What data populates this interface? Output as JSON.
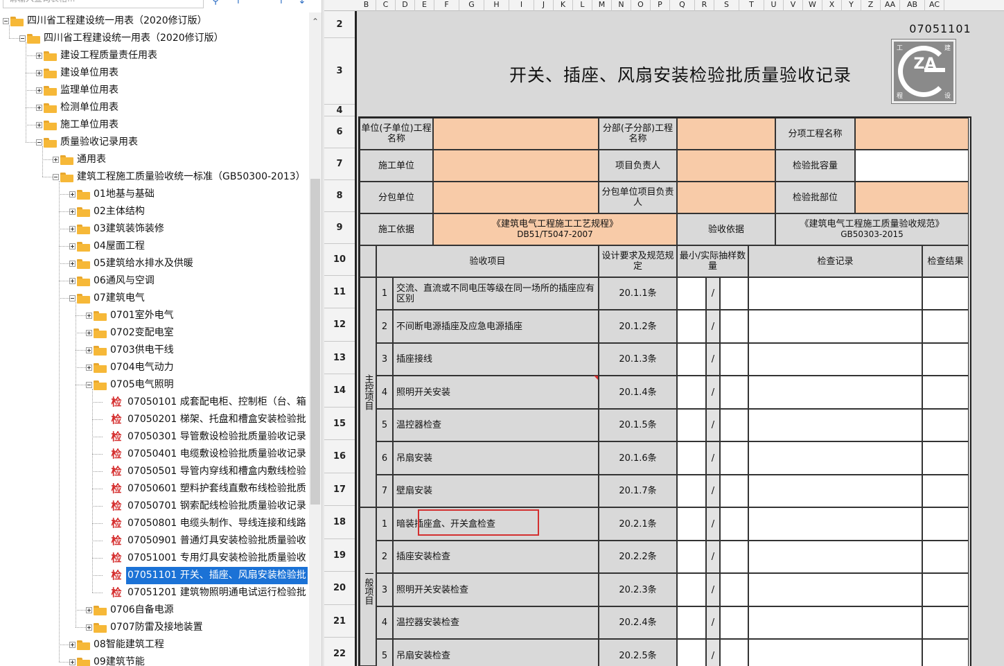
{
  "tree": {
    "search_placeholder": "请输入查询表格...",
    "nodes": [
      {
        "label": "四川省工程建设统一用表（2020修订版）",
        "indent": 0,
        "type": "folder",
        "expanded": true
      },
      {
        "label": "四川省工程建设统一用表（2020修订版）",
        "indent": 1,
        "type": "folder",
        "expanded": true
      },
      {
        "label": "建设工程质量责任用表",
        "indent": 2,
        "type": "folder",
        "expanded": false
      },
      {
        "label": "建设单位用表",
        "indent": 2,
        "type": "folder",
        "expanded": false
      },
      {
        "label": "监理单位用表",
        "indent": 2,
        "type": "folder",
        "expanded": false
      },
      {
        "label": "检测单位用表",
        "indent": 2,
        "type": "folder",
        "expanded": false
      },
      {
        "label": "施工单位用表",
        "indent": 2,
        "type": "folder",
        "expanded": false
      },
      {
        "label": "质量验收记录用表",
        "indent": 2,
        "type": "folder",
        "expanded": true
      },
      {
        "label": "通用表",
        "indent": 3,
        "type": "folder",
        "expanded": false
      },
      {
        "label": "建筑工程施工质量验收统一标准（GB50300-2013）",
        "indent": 3,
        "type": "folder",
        "expanded": true
      },
      {
        "label": "01地基与基础",
        "indent": 4,
        "type": "folder",
        "expanded": false
      },
      {
        "label": "02主体结构",
        "indent": 4,
        "type": "folder",
        "expanded": false
      },
      {
        "label": "03建筑装饰装修",
        "indent": 4,
        "type": "folder",
        "expanded": false
      },
      {
        "label": "04屋面工程",
        "indent": 4,
        "type": "folder",
        "expanded": false
      },
      {
        "label": "05建筑给水排水及供暖",
        "indent": 4,
        "type": "folder",
        "expanded": false
      },
      {
        "label": "06通风与空调",
        "indent": 4,
        "type": "folder",
        "expanded": false
      },
      {
        "label": "07建筑电气",
        "indent": 4,
        "type": "folder",
        "expanded": true
      },
      {
        "label": "0701室外电气",
        "indent": 5,
        "type": "folder",
        "expanded": false
      },
      {
        "label": "0702变配电室",
        "indent": 5,
        "type": "folder",
        "expanded": false
      },
      {
        "label": "0703供电干线",
        "indent": 5,
        "type": "folder",
        "expanded": false
      },
      {
        "label": "0704电气动力",
        "indent": 5,
        "type": "folder",
        "expanded": false
      },
      {
        "label": "0705电气照明",
        "indent": 5,
        "type": "folder",
        "expanded": true
      },
      {
        "label": "07050101 成套配电柜、控制柜（台、箱",
        "indent": 6,
        "type": "doc"
      },
      {
        "label": "07050201 梯架、托盘和槽盒安装检验批",
        "indent": 6,
        "type": "doc"
      },
      {
        "label": "07050301 导管敷设检验批质量验收记录",
        "indent": 6,
        "type": "doc"
      },
      {
        "label": "07050401 电缆敷设检验批质量验收记录",
        "indent": 6,
        "type": "doc"
      },
      {
        "label": "07050501 导管内穿线和槽盒内敷线检验",
        "indent": 6,
        "type": "doc"
      },
      {
        "label": "07050601 塑料护套线直敷布线检验批质",
        "indent": 6,
        "type": "doc"
      },
      {
        "label": "07050701 钢索配线检验批质量验收记录",
        "indent": 6,
        "type": "doc"
      },
      {
        "label": "07050801 电缆头制作、导线连接和线路",
        "indent": 6,
        "type": "doc"
      },
      {
        "label": "07050901 普通灯具安装检验批质量验收",
        "indent": 6,
        "type": "doc"
      },
      {
        "label": "07051001 专用灯具安装检验批质量验收",
        "indent": 6,
        "type": "doc"
      },
      {
        "label": "07051101 开关、插座、风扇安装检验批",
        "indent": 6,
        "type": "doc",
        "selected": true
      },
      {
        "label": "07051201 建筑物照明通电试运行检验批",
        "indent": 6,
        "type": "doc"
      },
      {
        "label": "0706自备电源",
        "indent": 5,
        "type": "folder",
        "expanded": false
      },
      {
        "label": "0707防雷及接地装置",
        "indent": 5,
        "type": "folder",
        "expanded": false
      },
      {
        "label": "08智能建筑工程",
        "indent": 4,
        "type": "folder",
        "expanded": false
      },
      {
        "label": "09建筑节能",
        "indent": 4,
        "type": "folder",
        "expanded": false
      }
    ],
    "doc_glyph": "检"
  },
  "sheet": {
    "columns": [
      "B",
      "C",
      "D",
      "E",
      "F",
      "G",
      "H",
      "I",
      "J",
      "K",
      "L",
      "M",
      "N",
      "O",
      "P",
      "Q",
      "R",
      "S",
      "T",
      "U",
      "V",
      "W",
      "X",
      "Y",
      "Z",
      "AA",
      "AB",
      "AC"
    ],
    "rows": [
      "2",
      "3",
      "4",
      "6",
      "7",
      "8",
      "9",
      "10",
      "11",
      "12",
      "13",
      "14",
      "15",
      "16",
      "17",
      "18",
      "19",
      "20",
      "21",
      "22"
    ],
    "form_code": "07051101",
    "logo_text": "ZA",
    "logo_corner_chars": [
      "工",
      "建",
      "程",
      "设"
    ],
    "title": "开关、插座、风扇安装检验批质量验收记录",
    "header": {
      "unit_label": "单位(子单位)工程名称",
      "division_label": "分部(子分部)工程名称",
      "item_label": "分项工程名称",
      "constructor_label": "施工单位",
      "pm_label": "项目负责人",
      "capacity_label": "检验批容量",
      "subcontractor_label": "分包单位",
      "sub_pm_label": "分包单位项目负责人",
      "location_label": "检验批部位",
      "basis_label": "施工依据",
      "basis_value_1": "《建筑电气工程施工工艺规程》",
      "basis_value_2": "DB51/T5047-2007",
      "acceptance_label": "验收依据",
      "acceptance_value_1": "《建筑电气工程施工质量验收规范》",
      "acceptance_value_2": "GB50303-2015"
    },
    "table_header": {
      "item": "验收项目",
      "design": "设计要求及规范规定",
      "sample": "最小/实际抽样数量",
      "record": "检查记录",
      "result": "检查结果"
    },
    "main_label": "主控项目",
    "general_label": "一般项目",
    "main_items": [
      {
        "no": "1",
        "text": "交流、直流或不同电压等级在同一场所的插座应有区别",
        "clause": "20.1.1条"
      },
      {
        "no": "2",
        "text": "不间断电源插座及应急电源插座",
        "clause": "20.1.2条"
      },
      {
        "no": "3",
        "text": "插座接线",
        "clause": "20.1.3条"
      },
      {
        "no": "4",
        "text": "照明开关安装",
        "clause": "20.1.4条"
      },
      {
        "no": "5",
        "text": "温控器检查",
        "clause": "20.1.5条"
      },
      {
        "no": "6",
        "text": "吊扇安装",
        "clause": "20.1.6条"
      },
      {
        "no": "7",
        "text": "壁扇安装",
        "clause": "20.1.7条"
      }
    ],
    "general_items": [
      {
        "no": "1",
        "text": "暗装插座盒、开关盒检查",
        "clause": "20.2.1条"
      },
      {
        "no": "2",
        "text": "插座安装检查",
        "clause": "20.2.2条"
      },
      {
        "no": "3",
        "text": "照明开关安装检查",
        "clause": "20.2.3条"
      },
      {
        "no": "4",
        "text": "温控器安装检查",
        "clause": "20.2.4条"
      },
      {
        "no": "5",
        "text": "吊扇安装检查",
        "clause": "20.2.5条"
      }
    ],
    "slash": "/"
  },
  "colors": {
    "accent_selected": "#1b72d6",
    "peach_fill": "#f8cba8",
    "highlight_box": "#d32f2f"
  }
}
